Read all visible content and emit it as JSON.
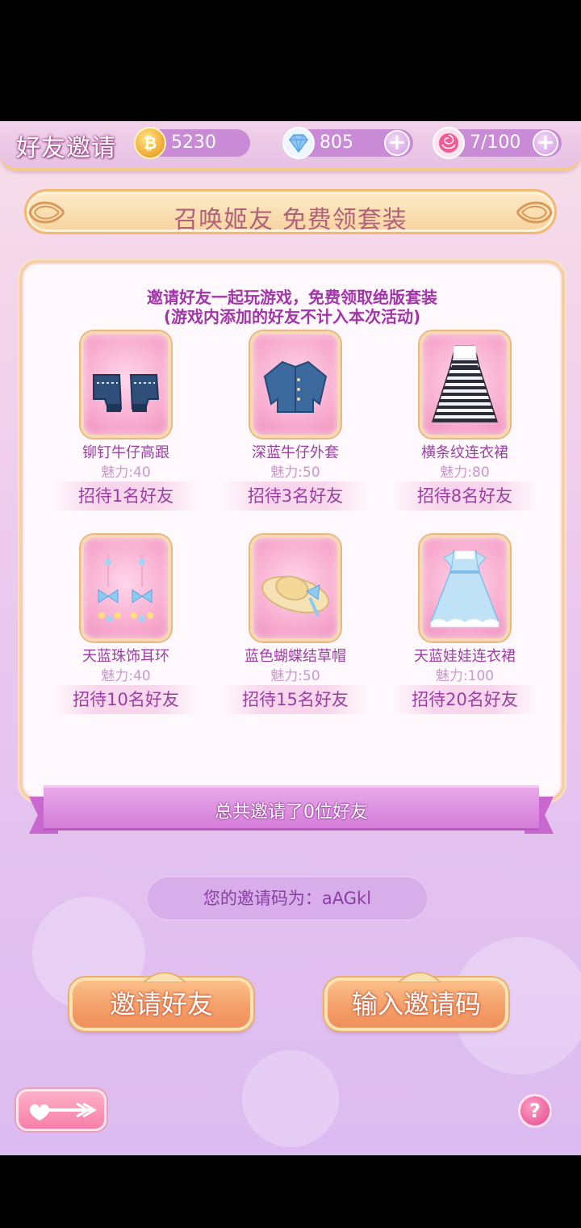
{
  "header": {
    "title": "好友邀请",
    "coins": "5230",
    "diamonds": "805",
    "stamina": "7/100"
  },
  "banner": {
    "title": "召唤姬友 免费领套装"
  },
  "panel": {
    "desc_line1": "邀请好友一起玩游戏，免费领取绝版套装",
    "desc_line2": "(游戏内添加的好友不计入本次活动)",
    "rewards": [
      {
        "name": "铆钉牛仔高跟",
        "charm": "魅力:40",
        "requirement": "招待1名好友",
        "icon": "denim-heels-icon"
      },
      {
        "name": "深蓝牛仔外套",
        "charm": "魅力:50",
        "requirement": "招待3名好友",
        "icon": "denim-jacket-icon"
      },
      {
        "name": "横条纹连衣裙",
        "charm": "魅力:80",
        "requirement": "招待8名好友",
        "icon": "striped-dress-icon"
      },
      {
        "name": "天蓝珠饰耳环",
        "charm": "魅力:40",
        "requirement": "招待10名好友",
        "icon": "earrings-icon"
      },
      {
        "name": "蓝色蝴蝶结草帽",
        "charm": "魅力:50",
        "requirement": "招待15名好友",
        "icon": "straw-hat-icon"
      },
      {
        "name": "天蓝娃娃连衣裙",
        "charm": "魅力:100",
        "requirement": "招待20名好友",
        "icon": "doll-dress-icon"
      }
    ]
  },
  "summary": {
    "total_invited": "总共邀请了0位好友"
  },
  "invite_code": {
    "text": "您的邀请码为：aAGkl"
  },
  "actions": {
    "invite_label": "邀请好友",
    "enter_code_label": "输入邀请码"
  },
  "footer": {
    "help_label": "?"
  }
}
